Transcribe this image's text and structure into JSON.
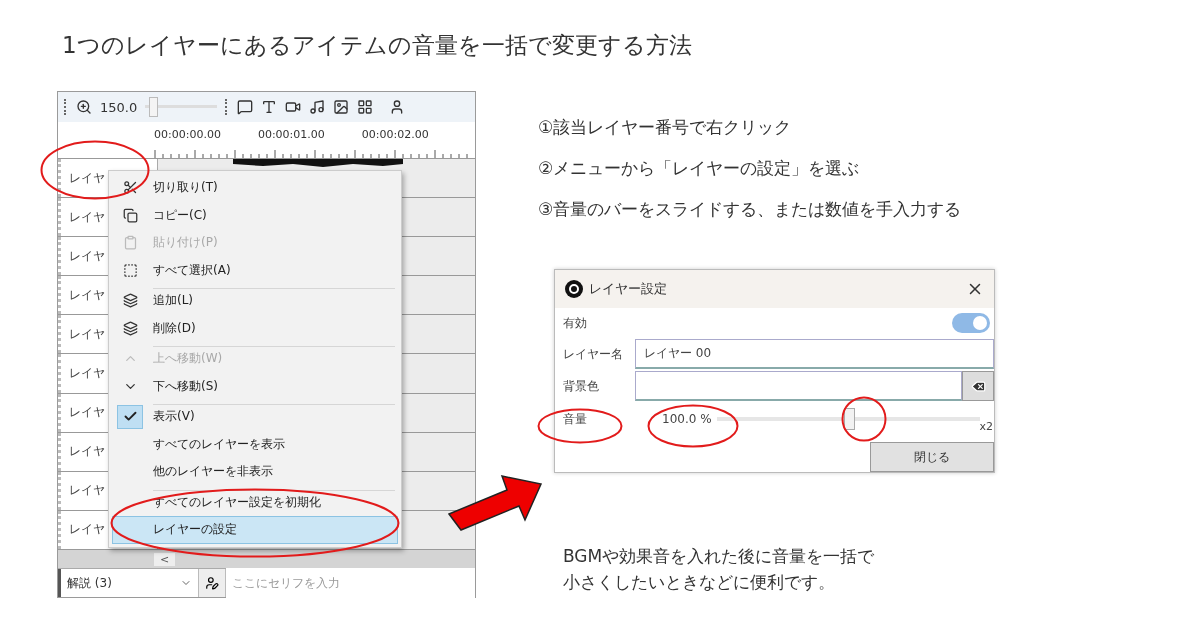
{
  "title": "1つのレイヤーにあるアイテムの音量を一括で変更する方法",
  "timeline": {
    "zoom_value": "150.0",
    "zoom_slider": {
      "level": 0.05
    },
    "timecodes": [
      "00:00:00.00",
      "00:00:01.00",
      "00:00:02.00"
    ],
    "layer_rows": [
      {
        "label": "レイヤ"
      },
      {
        "label": "レイヤ"
      },
      {
        "label": "レイヤ"
      },
      {
        "label": "レイヤ"
      },
      {
        "label": "レイヤ"
      },
      {
        "label": "レイヤ"
      },
      {
        "label": "レイヤ"
      },
      {
        "label": "レイヤ"
      },
      {
        "label": "レイヤ"
      },
      {
        "label": "レイヤ"
      }
    ],
    "context_menu": [
      {
        "label": "切り取り(T)",
        "disabled": false,
        "checked": false,
        "selected": false,
        "separator_before": false
      },
      {
        "label": "コピー(C)",
        "disabled": false,
        "checked": false,
        "selected": false,
        "separator_before": false
      },
      {
        "label": "貼り付け(P)",
        "disabled": true,
        "checked": false,
        "selected": false,
        "separator_before": false
      },
      {
        "label": "すべて選択(A)",
        "disabled": false,
        "checked": false,
        "selected": false,
        "separator_before": false
      },
      {
        "label": "追加(L)",
        "disabled": false,
        "checked": false,
        "selected": false,
        "separator_before": true
      },
      {
        "label": "削除(D)",
        "disabled": false,
        "checked": false,
        "selected": false,
        "separator_before": false
      },
      {
        "label": "上へ移動(W)",
        "disabled": true,
        "checked": false,
        "selected": false,
        "separator_before": true
      },
      {
        "label": "下へ移動(S)",
        "disabled": false,
        "checked": false,
        "selected": false,
        "separator_before": false
      },
      {
        "label": "表示(V)",
        "disabled": false,
        "checked": true,
        "selected": false,
        "separator_before": true
      },
      {
        "label": "すべてのレイヤーを表示",
        "disabled": false,
        "checked": false,
        "selected": false,
        "separator_before": false
      },
      {
        "label": "他のレイヤーを非表示",
        "disabled": false,
        "checked": false,
        "selected": false,
        "separator_before": false
      },
      {
        "label": "すべてのレイヤー設定を初期化",
        "disabled": false,
        "checked": false,
        "selected": false,
        "separator_before": true
      },
      {
        "label": "レイヤーの設定",
        "disabled": false,
        "checked": false,
        "selected": true,
        "separator_before": false
      }
    ],
    "scroll_arrow": "<",
    "character_select": "解説 (3)",
    "line_input": {
      "placeholder": "ここにセリフを入力"
    }
  },
  "steps": [
    "①該当レイヤー番号で右クリック",
    "②メニューから「レイヤーの設定」を選ぶ",
    "③音量のバーをスライドする、または数値を手入力する"
  ],
  "dialog": {
    "title": "レイヤー設定",
    "enabled": {
      "label": "有効",
      "on": true
    },
    "name": {
      "label": "レイヤー名",
      "value": "レイヤー 00"
    },
    "background": {
      "label": "背景色"
    },
    "volume": {
      "label": "音量",
      "reading": "100.0 %",
      "level": 0.5,
      "max_label": "x2"
    },
    "close_button": "閉じる"
  },
  "note": [
    "BGMや効果音を入れた後に音量を一括で",
    "小さくしたいときなどに便利です。"
  ]
}
